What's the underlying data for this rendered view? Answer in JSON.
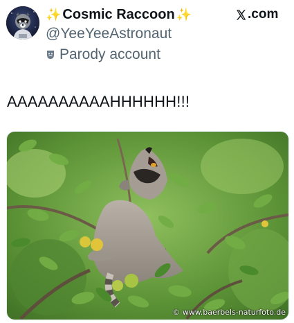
{
  "author": {
    "display_name": "Cosmic Raccoon",
    "sparkle_left": "✨",
    "sparkle_right": "✨",
    "handle": "@YeeYeeAstronaut",
    "badge_label": "Parody account",
    "avatar_icon": "astronaut-raccoon-avatar"
  },
  "site": {
    "label": ".com",
    "logo_icon": "x-logo-icon"
  },
  "post": {
    "text": "AAAAAAAAAAHHHHHH!!!",
    "media": {
      "description_icon": "raccoon-in-tree-photo",
      "watermark": "© www.baerbels-naturfoto.de"
    }
  },
  "colors": {
    "secondary_text": "#536471",
    "sparkle": "#f5b400",
    "leaf_green": "#5f9a3a"
  }
}
